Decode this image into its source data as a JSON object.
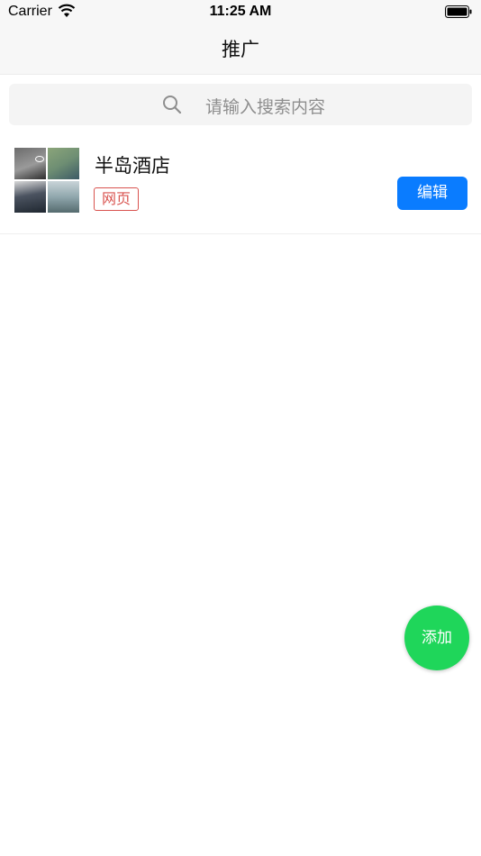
{
  "status_bar": {
    "carrier": "Carrier",
    "time": "11:25 AM",
    "wifi_icon": "wifi-icon",
    "battery_icon": "battery-icon"
  },
  "nav": {
    "title": "推广"
  },
  "search": {
    "placeholder": "请输入搜索内容",
    "icon": "search-icon"
  },
  "list": {
    "items": [
      {
        "title": "半岛酒店",
        "tag": "网页",
        "edit_label": "编辑"
      }
    ]
  },
  "fab": {
    "label": "添加"
  },
  "colors": {
    "edit_button": "#0a7cff",
    "fab": "#1fd65a",
    "tag": "#d9534f"
  }
}
